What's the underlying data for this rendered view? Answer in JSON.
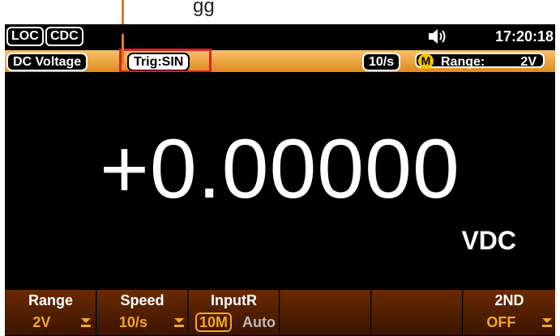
{
  "annotation": {
    "text": "gg"
  },
  "top_bar": {
    "loc_label": "LOC",
    "cdc_label": "CDC",
    "time": "17:20:18",
    "speaker_icon": "speaker-icon"
  },
  "status_bar": {
    "function": "DC Voltage",
    "trigger": "Trig:SIN",
    "rate": "10/s",
    "math_badge": "M",
    "range_label": "Range:",
    "range_value": "2V"
  },
  "readout": {
    "value": "+0.00000",
    "unit": "VDC"
  },
  "softkeys": [
    {
      "label": "Range",
      "value": "2V"
    },
    {
      "label": "Speed",
      "value": "10/s"
    },
    {
      "label": "InputR",
      "value_selected": "10M",
      "value_other": "Auto"
    },
    {
      "label": "",
      "value": ""
    },
    {
      "label": "",
      "value": ""
    },
    {
      "label": "2ND",
      "value": "OFF"
    }
  ],
  "colors": {
    "accent": "#f5a623",
    "annotation_line": "#e87722",
    "highlight_box": "#e01e24"
  }
}
